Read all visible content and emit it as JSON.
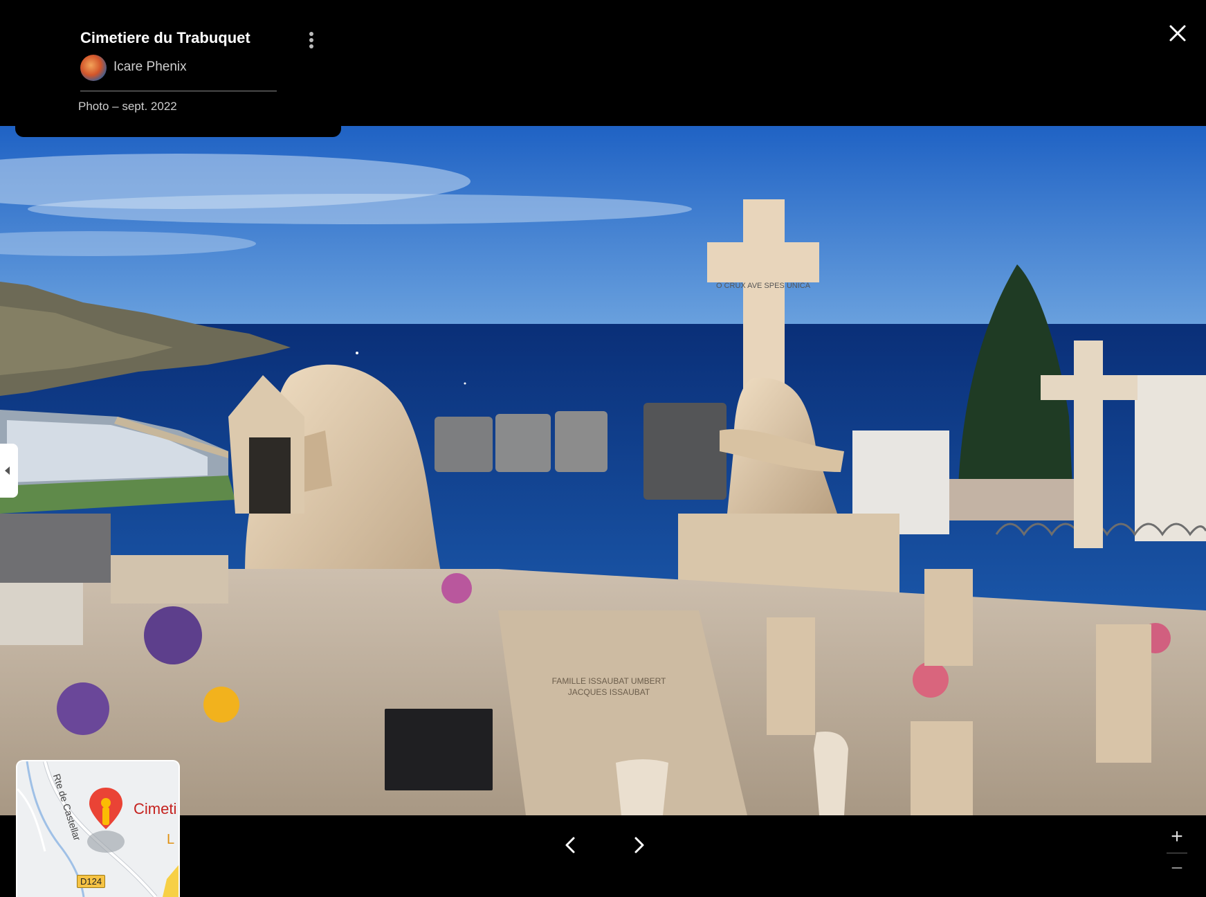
{
  "header": {
    "place_title": "Cimetiere du Trabuquet",
    "author_name": "Icare Phenix",
    "photo_date": "Photo – sept. 2022"
  },
  "photo": {
    "cross_inscription": "O CRUX AVE SPES UNICA",
    "grave_inscription_1": "FAMILLE ISSAUBAT UMBERT",
    "grave_inscription_2": "JACQUES ISSAUBAT"
  },
  "minimap": {
    "place_label": "Cimeti",
    "road_label": "Rte de Castellar",
    "route_badge": "D124",
    "partial_label": "L"
  },
  "controls": {
    "zoom_in": "+",
    "zoom_out": "−"
  },
  "colors": {
    "background": "#000000",
    "sea": "#0d3f8f",
    "sky": "#3f7bd1",
    "marble": "#e6cfae",
    "pin": "#ea4335"
  }
}
